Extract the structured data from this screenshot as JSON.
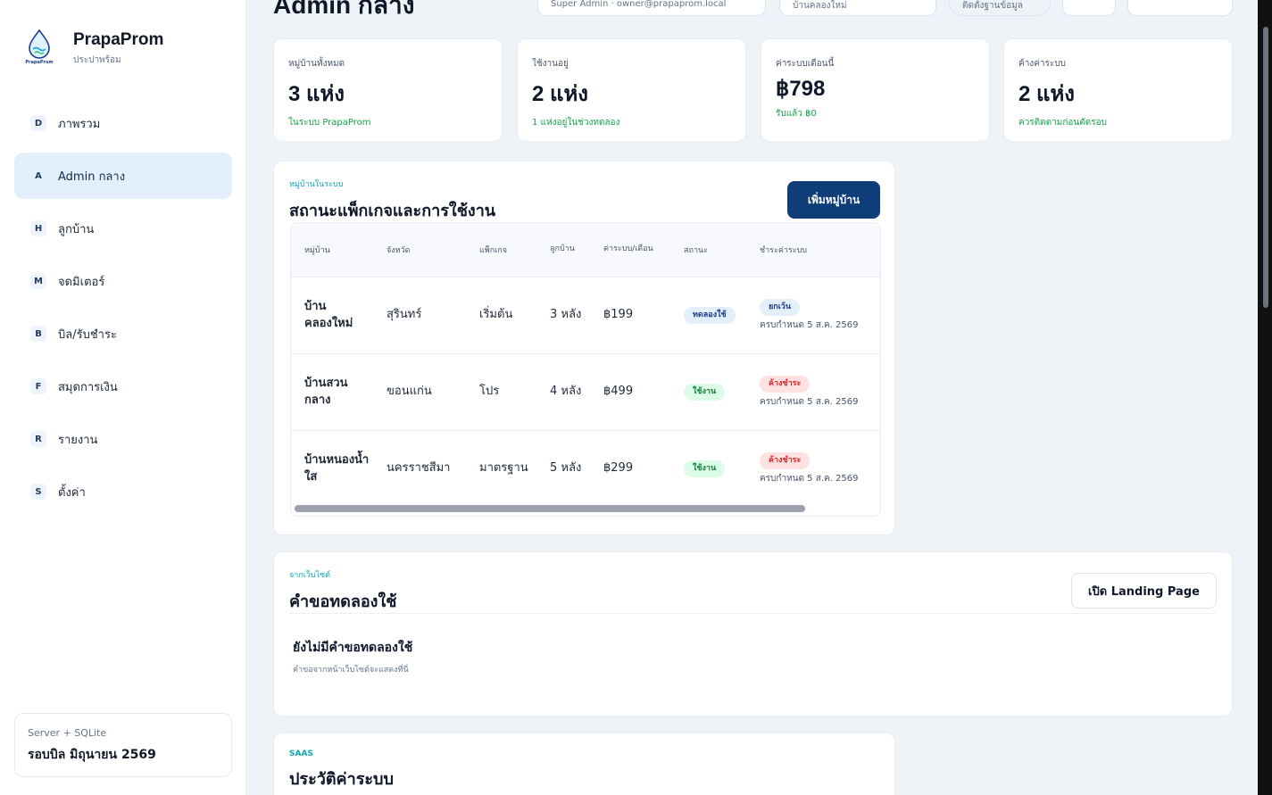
{
  "brand": {
    "name": "PrapaProm",
    "subtitle": "ประปาพร้อม",
    "logo_text": "PrapaProm"
  },
  "nav": [
    {
      "key": "D",
      "label": "ภาพรวม"
    },
    {
      "key": "A",
      "label": "Admin กลาง",
      "active": true
    },
    {
      "key": "H",
      "label": "ลูกบ้าน"
    },
    {
      "key": "M",
      "label": "จดมิเตอร์"
    },
    {
      "key": "B",
      "label": "บิล/รับชำระ"
    },
    {
      "key": "F",
      "label": "สมุดการเงิน"
    },
    {
      "key": "R",
      "label": "รายงาน"
    },
    {
      "key": "S",
      "label": "ตั้งค่า"
    }
  ],
  "server": {
    "label": "Server + SQLite",
    "cycle": "รอบบิล มิถุนายน 2569"
  },
  "topbar": {
    "title": "Admin กลาง",
    "user": "Super Admin · owner@prapaprom.local",
    "select": "บ้านคลองใหม่",
    "pill": "ติดตั้งฐานข้อมูล"
  },
  "stats": [
    {
      "label": "หมู่บ้านทั้งหมด",
      "value": "3 แห่ง",
      "note": "ในระบบ PrapaProm"
    },
    {
      "label": "ใช้งานอยู่",
      "value": "2 แห่ง",
      "note": "1 แห่งอยู่ในช่วงทดลอง"
    },
    {
      "label": "ค่าระบบเดือนนี้",
      "value": "฿798",
      "note": "รับแล้ว ฿0"
    },
    {
      "label": "ค้างค่าระบบ",
      "value": "2 แห่ง",
      "note": "ควรติดตามก่อนตัดรอบ"
    }
  ],
  "villages": {
    "eyebrow": "หมู่บ้านในระบบ",
    "title": "สถานะแพ็กเกจและการใช้งาน",
    "add_button": "เพิ่มหมู่บ้าน",
    "headers": [
      "หมู่บ้าน",
      "จังหวัด",
      "แพ็กเกจ",
      "ลูกบ้าน",
      "ค่าระบบ/เดือน",
      "สถานะ",
      "ชำระค่าระบบ"
    ],
    "rows": [
      {
        "name": "บ้านคลองใหม่",
        "province": "สุรินทร์",
        "plan": "เริ่มต้น",
        "houses": "3 หลัง",
        "fee": "฿199",
        "status": "ทดลองใช้",
        "status_kind": "trial",
        "payment": "ยกเว้น",
        "payment_kind": "waived",
        "due": "ครบกำหนด 5 ส.ค. 2569"
      },
      {
        "name": "บ้านสวนกลาง",
        "province": "ขอนแก่น",
        "plan": "โปร",
        "houses": "4 หลัง",
        "fee": "฿499",
        "status": "ใช้งาน",
        "status_kind": "active",
        "payment": "ค้างชำระ",
        "payment_kind": "overdue",
        "due": "ครบกำหนด 5 ส.ค. 2569"
      },
      {
        "name": "บ้านหนองน้ำใส",
        "province": "นครราชสีมา",
        "plan": "มาตรฐาน",
        "houses": "5 หลัง",
        "fee": "฿299",
        "status": "ใช้งาน",
        "status_kind": "active",
        "payment": "ค้างชำระ",
        "payment_kind": "overdue",
        "due": "ครบกำหนด 5 ส.ค. 2569"
      }
    ]
  },
  "trial": {
    "eyebrow": "จากเว็บไซต์",
    "title": "คำขอทดลองใช้",
    "button": "เปิด Landing Page",
    "empty_title": "ยังไม่มีคำขอทดลองใช้",
    "empty_sub": "คำขอจากหน้าเว็บไซต์จะแสดงที่นี่"
  },
  "history": {
    "eyebrow": "SAAS",
    "title": "ประวัติค่าระบบ"
  },
  "colors": {
    "primary": "#0f3d78",
    "accent": "#0ea5b7",
    "positive": "#16a34a",
    "danger": "#dc2626"
  }
}
